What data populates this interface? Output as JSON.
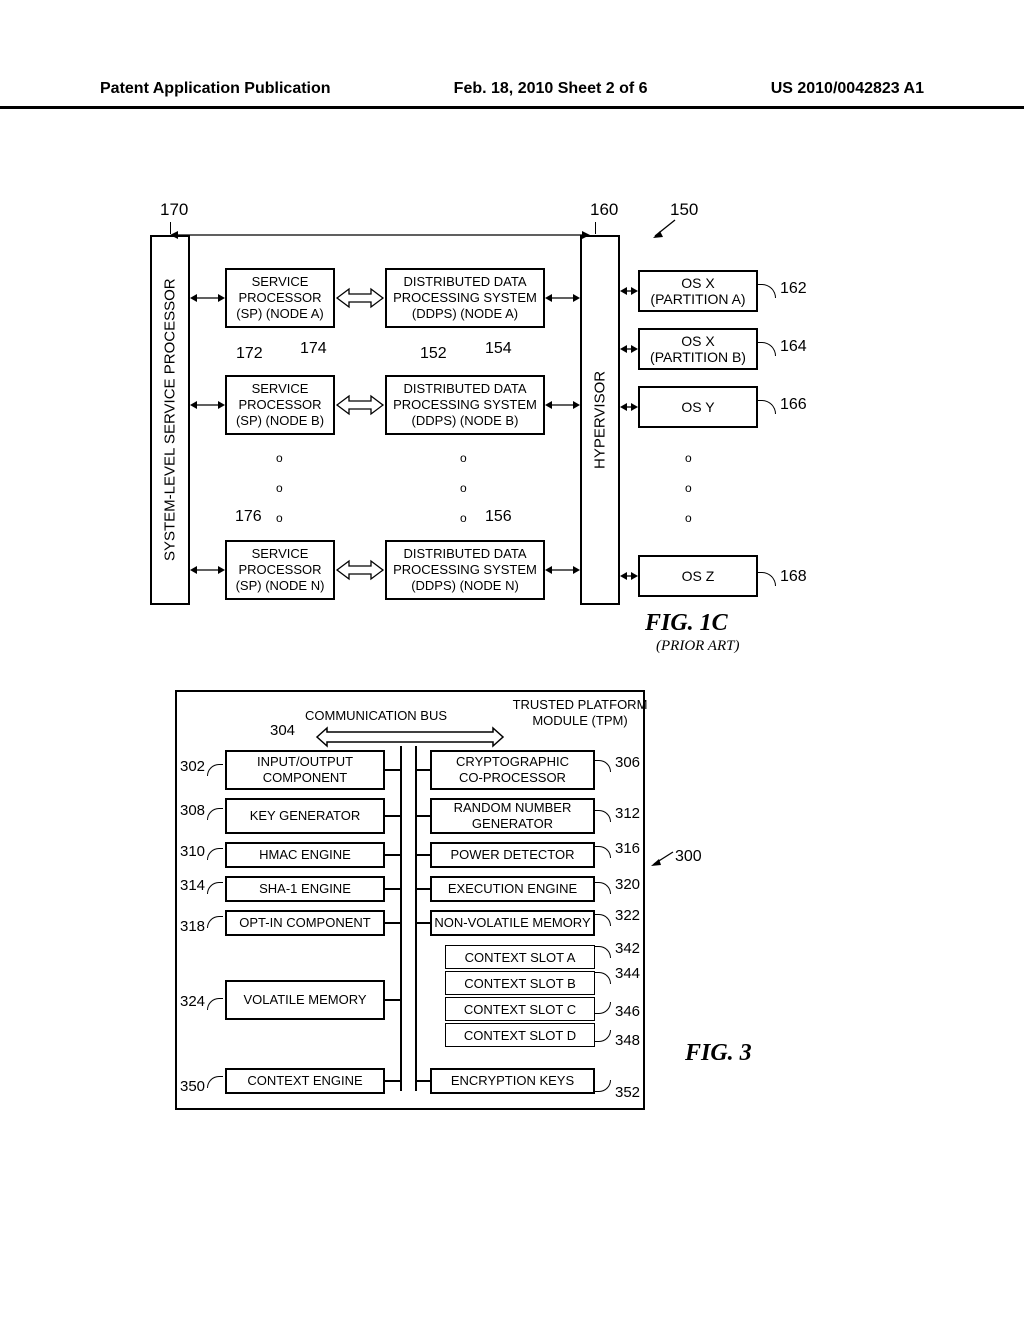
{
  "header": {
    "left": "Patent Application Publication",
    "center": "Feb. 18, 2010   Sheet 2 of 6",
    "right": "US 2010/0042823 A1"
  },
  "fig1c": {
    "label": "FIG. 1C",
    "sublabel": "(PRIOR ART)",
    "refs": {
      "r170": "170",
      "r160": "160",
      "r150": "150",
      "r172": "172",
      "r174": "174",
      "r152": "152",
      "r154": "154",
      "r162": "162",
      "r164": "164",
      "r166": "166",
      "r168": "168",
      "r176": "176",
      "r156": "156"
    },
    "slsp": "SYSTEM-LEVEL SERVICE PROCESSOR",
    "hypervisor": "HYPERVISOR",
    "sp": {
      "a": "SERVICE\nPROCESSOR\n(SP) (NODE A)",
      "b": "SERVICE\nPROCESSOR\n(SP) (NODE B)",
      "n": "SERVICE\nPROCESSOR\n(SP) (NODE N)"
    },
    "ddps": {
      "a": "DISTRIBUTED DATA\nPROCESSING SYSTEM\n(DDPS) (NODE A)",
      "b": "DISTRIBUTED DATA\nPROCESSING SYSTEM\n(DDPS) (NODE B)",
      "n": "DISTRIBUTED DATA\nPROCESSING SYSTEM\n(DDPS) (NODE N)"
    },
    "os": {
      "x_a": "OS X\n(PARTITION A)",
      "x_b": "OS X\n(PARTITION B)",
      "y": "OS Y",
      "z": "OS Z"
    }
  },
  "fig3": {
    "label": "FIG. 3",
    "title": "TRUSTED PLATFORM\nMODULE (TPM)",
    "bus_label": "COMMUNICATION BUS",
    "refs": {
      "r300": "300",
      "r302": "302",
      "r304": "304",
      "r306": "306",
      "r308": "308",
      "r310": "310",
      "r312": "312",
      "r314": "314",
      "r316": "316",
      "r318": "318",
      "r320": "320",
      "r322": "322",
      "r324": "324",
      "r342": "342",
      "r344": "344",
      "r346": "346",
      "r348": "348",
      "r350": "350",
      "r352": "352"
    },
    "comp": {
      "io": "INPUT/OUTPUT\nCOMPONENT",
      "crypto": "CRYPTOGRAPHIC\nCO-PROCESSOR",
      "keygen": "KEY GENERATOR",
      "rng": "RANDOM NUMBER\nGENERATOR",
      "hmac": "HMAC ENGINE",
      "power": "POWER DETECTOR",
      "sha1": "SHA-1 ENGINE",
      "exec": "EXECUTION ENGINE",
      "optin": "OPT-IN COMPONENT",
      "nvmem": "NON-VOLATILE MEMORY",
      "volmem": "VOLATILE MEMORY",
      "ctxeng": "CONTEXT ENGINE",
      "enckeys": "ENCRYPTION KEYS",
      "slot_a": "CONTEXT SLOT A",
      "slot_b": "CONTEXT SLOT B",
      "slot_c": "CONTEXT SLOT C",
      "slot_d": "CONTEXT SLOT D"
    }
  }
}
